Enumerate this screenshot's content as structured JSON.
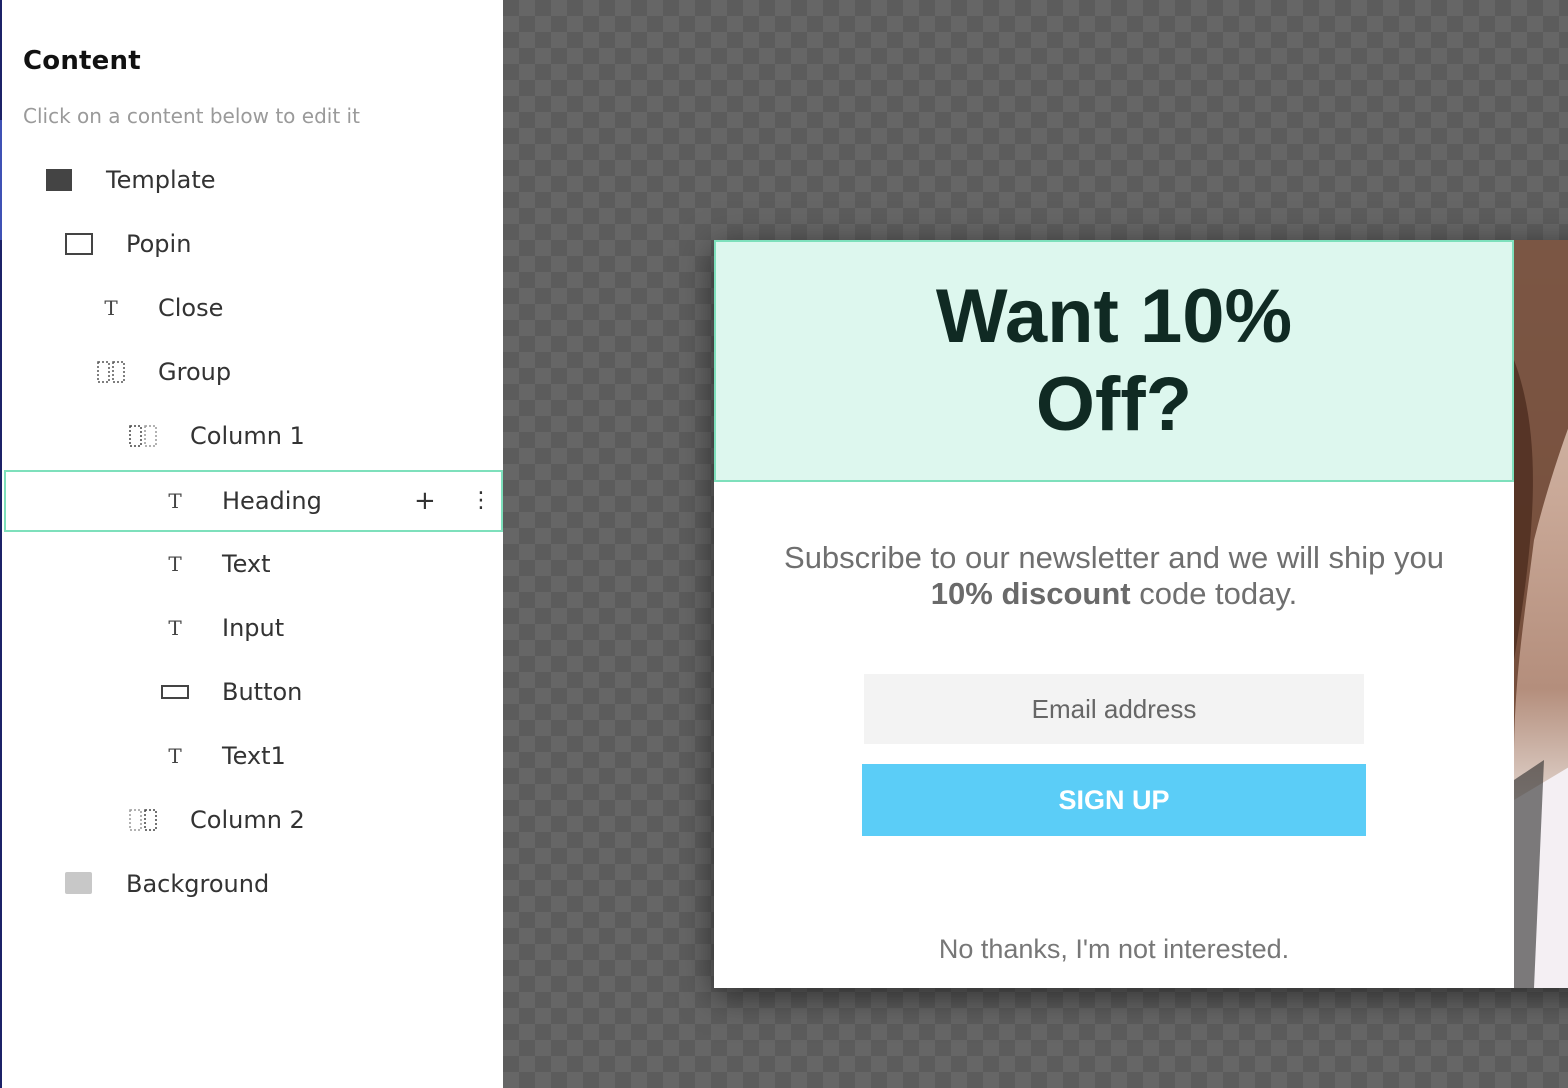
{
  "panel": {
    "title": "Content",
    "subtitle": "Click on a content below to edit it",
    "tree": [
      {
        "label": "Template",
        "icon": "filled-square-icon",
        "depth": 0
      },
      {
        "label": "Popin",
        "icon": "outlined-square-icon",
        "depth": 1
      },
      {
        "label": "Close",
        "icon": "text-t-icon",
        "depth": 2
      },
      {
        "label": "Group",
        "icon": "columns-icon",
        "depth": 2
      },
      {
        "label": "Column 1",
        "icon": "column-icon",
        "depth": 3
      },
      {
        "label": "Heading",
        "icon": "text-t-icon",
        "depth": 4,
        "selected": true
      },
      {
        "label": "Text",
        "icon": "text-t-icon",
        "depth": 4
      },
      {
        "label": "Input",
        "icon": "text-t-icon",
        "depth": 4
      },
      {
        "label": "Button",
        "icon": "button-rect-icon",
        "depth": 4
      },
      {
        "label": "Text1",
        "icon": "text-t-icon",
        "depth": 4
      },
      {
        "label": "Column 2",
        "icon": "column-icon",
        "depth": 3
      },
      {
        "label": "Background",
        "icon": "gray-swatch-icon",
        "depth": 1
      }
    ],
    "selected_actions": {
      "add": "+",
      "more": "⋮"
    }
  },
  "popin": {
    "heading_line1": "Want 10%",
    "heading_line2": "Off?",
    "text_part1": "Subscribe to our newsletter and we will ship you",
    "text_bold": "10% discount",
    "text_part2": " code today.",
    "input_placeholder": "Email address",
    "button_label": "SIGN UP",
    "decline_text": "No thanks, I'm not interested."
  },
  "colors": {
    "heading_bg": "#ddf7ee",
    "selection_border": "#7ee0bc",
    "button_bg": "#5bcdf7",
    "heading_text": "#102a23"
  }
}
